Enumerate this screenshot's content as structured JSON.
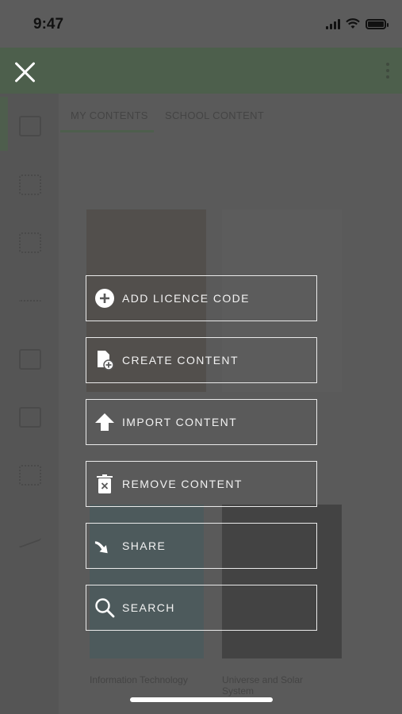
{
  "status_bar": {
    "time": "9:47"
  },
  "background": {
    "tabs": [
      "MY CONTENTS",
      "SCHOOL CONTENT"
    ],
    "cards": [
      {
        "title": "Information Technology"
      },
      {
        "title": "Universe and Solar System"
      }
    ]
  },
  "menu": {
    "items": [
      {
        "label": "ADD LICENCE CODE",
        "icon": "plus-circle-icon"
      },
      {
        "label": "CREATE CONTENT",
        "icon": "create-document-icon"
      },
      {
        "label": "IMPORT CONTENT",
        "icon": "import-arrow-icon"
      },
      {
        "label": "REMOVE CONTENT",
        "icon": "trash-icon"
      },
      {
        "label": "SHARE",
        "icon": "share-arrow-icon"
      },
      {
        "label": "SEARCH",
        "icon": "search-icon"
      }
    ]
  }
}
